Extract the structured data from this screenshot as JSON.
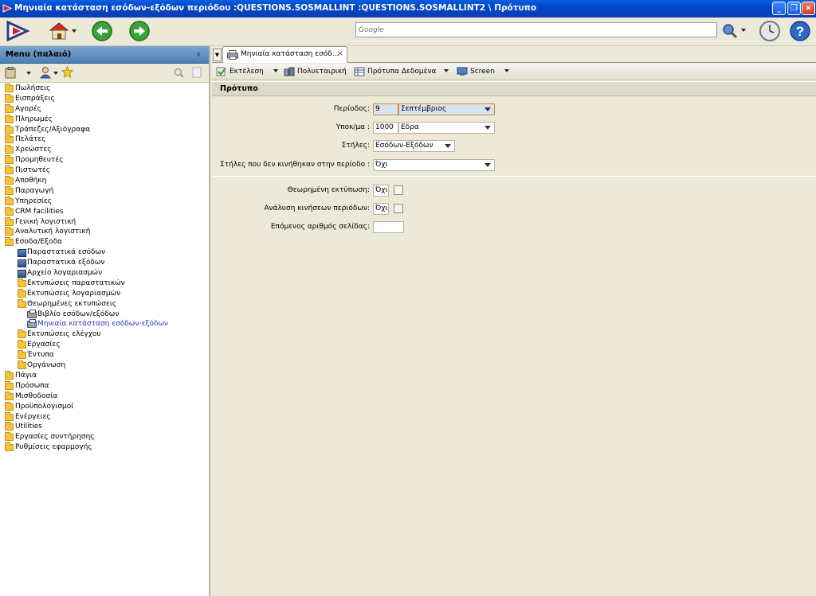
{
  "window": {
    "title": "Μηνιαία κατάσταση εσόδων-εξόδων περιόδου :QUESTIONS.SOSMALLINT :QUESTIONS.SOSMALLINT2 \\ Πρότυπο"
  },
  "toolbar": {
    "search_placeholder": "Google"
  },
  "menu": {
    "header": "Menu (παλαιό)",
    "collapse_glyph": "‹",
    "items": [
      {
        "label": "Πωλήσεις",
        "icon": "folder-icon"
      },
      {
        "label": "Εισπράξεις",
        "icon": "folder-icon"
      },
      {
        "label": "Αγορές",
        "icon": "folder-icon"
      },
      {
        "label": "Πληρωμές",
        "icon": "folder-icon"
      },
      {
        "label": "Τράπεζες/Αξιόγραφα",
        "icon": "folder-icon"
      },
      {
        "label": "Πελάτες",
        "icon": "folder-icon"
      },
      {
        "label": "Χρεώστες",
        "icon": "folder-icon"
      },
      {
        "label": "Προμηθευτές",
        "icon": "folder-icon"
      },
      {
        "label": "Πιστωτές",
        "icon": "folder-icon"
      },
      {
        "label": "Αποθήκη",
        "icon": "folder-icon"
      },
      {
        "label": "Παραγωγή",
        "icon": "folder-icon"
      },
      {
        "label": "Υπηρεσίες",
        "icon": "folder-icon"
      },
      {
        "label": "CRM facilities",
        "icon": "folder-icon"
      },
      {
        "label": "Γενική λογιστική",
        "icon": "folder-icon"
      },
      {
        "label": "Αναλυτική λογιστική",
        "icon": "folder-icon"
      },
      {
        "label": "Εσοδα/Εξοδα",
        "icon": "folder-icon"
      },
      {
        "label": "Παραστατικά εσόδων",
        "icon": "document-icon"
      },
      {
        "label": "Παραστατικά εξόδων",
        "icon": "document-icon"
      },
      {
        "label": "Αρχείο λογαριασμών",
        "icon": "document-icon"
      },
      {
        "label": "Εκτυπώσεις παραστατικών",
        "icon": "folder-icon"
      },
      {
        "label": "Εκτυπώσεις λογαριασμών",
        "icon": "folder-icon"
      },
      {
        "label": "Θεωρημένες εκτυπώσεις",
        "icon": "folder-icon"
      },
      {
        "label": "Βιβλίο εσόδων/εξόδων",
        "icon": "printer-icon"
      },
      {
        "label": "Μηνιαία κατάσταση εσόδων-εξόδων",
        "icon": "printer-icon",
        "selected": true
      },
      {
        "label": "Εκτυπώσεις ελέγχου",
        "icon": "folder-icon"
      },
      {
        "label": "Εργασίες",
        "icon": "folder-icon"
      },
      {
        "label": "Έντυπα",
        "icon": "folder-icon"
      },
      {
        "label": "Οργάνωση",
        "icon": "folder-icon"
      },
      {
        "label": "Πάγια",
        "icon": "folder-icon"
      },
      {
        "label": "Πρόσωπα",
        "icon": "folder-icon"
      },
      {
        "label": "Μισθοδοσία",
        "icon": "folder-icon"
      },
      {
        "label": "Προϋπολογισμοί",
        "icon": "folder-icon"
      },
      {
        "label": "Ενέργειες",
        "icon": "folder-icon"
      },
      {
        "label": "Utilities",
        "icon": "folder-icon"
      },
      {
        "label": "Εργασίες συντήρησης",
        "icon": "folder-icon"
      },
      {
        "label": "Ρυθμίσεις εφαρμογής",
        "icon": "folder-icon"
      }
    ]
  },
  "tab": {
    "label": "Μηνιαία κατάσταση εσόδ...",
    "close_glyph": "×"
  },
  "actions": {
    "run": "Εκτέλεση",
    "multicompany": "Πολυεταιρική",
    "templates": "Πρότυπα Δεδομένα",
    "screen": "Screen"
  },
  "section": {
    "title": "Πρότυπο"
  },
  "form": {
    "period_label": "Περίοδος:",
    "period_code": "9",
    "period_name": "Σεπτέμβριος",
    "branch_label": "Υποκ/μα :",
    "branch_code": "1000",
    "branch_name": "Εδρα",
    "columns_label": "Στήλες:",
    "columns_value": "Εσόδων-Εξόδων",
    "unmoved_label": "Στήλες που δεν κινήθηκαν στην περίοδο :",
    "unmoved_value": "Όχι",
    "certified_label": "Θεωρημένη εκτύπωση:",
    "certified_value": "Όχι",
    "analysis_label": "Ανάλυση κινήσεων περιόδων:",
    "analysis_value": "Όχι",
    "nextpage_label": "Επόμενος αριθμός σελίδας:",
    "nextpage_value": ""
  },
  "colors": {
    "titlebar": "#0346c8",
    "menu_header": "#4f7fb3",
    "selected_item": "#2a37b8",
    "highlight_field": "#d7e3ef"
  }
}
